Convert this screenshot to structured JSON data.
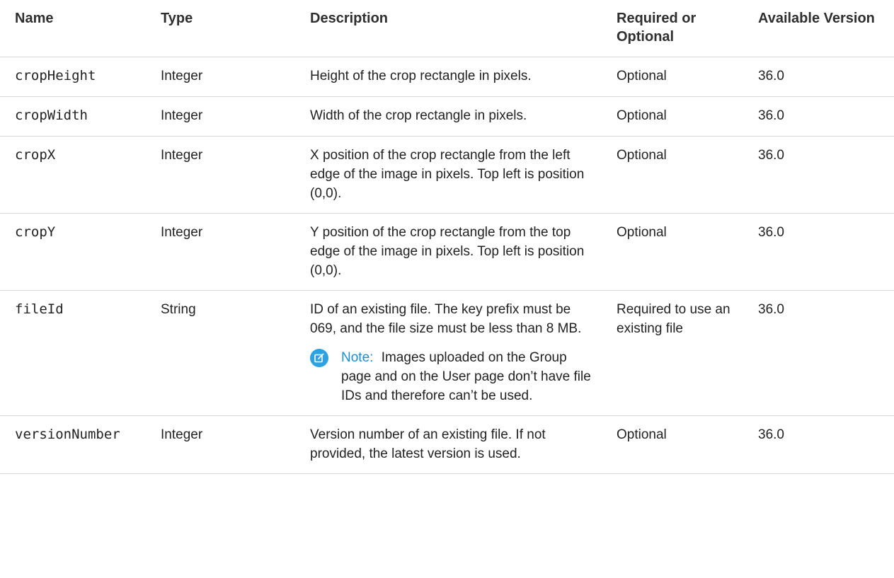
{
  "headers": {
    "name": "Name",
    "type": "Type",
    "description": "Description",
    "required": "Required or Optional",
    "version": "Available Version"
  },
  "rows": [
    {
      "name": "cropHeight",
      "type": "Integer",
      "description": "Height of the crop rectangle in pixels.",
      "required": "Optional",
      "version": "36.0"
    },
    {
      "name": "cropWidth",
      "type": "Integer",
      "description": "Width of the crop rectangle in pixels.",
      "required": "Optional",
      "version": "36.0"
    },
    {
      "name": "cropX",
      "type": "Integer",
      "description": "X position of the crop rectangle from the left edge of the image in pixels. Top left is position (0,0).",
      "required": "Optional",
      "version": "36.0"
    },
    {
      "name": "cropY",
      "type": "Integer",
      "description": "Y position of the crop rectangle from the top edge of the image in pixels. Top left is position (0,0).",
      "required": "Optional",
      "version": "36.0"
    },
    {
      "name": "fileId",
      "type": "String",
      "description": "ID of an existing file. The key prefix must be 069, and the file size must be less than 8 MB.",
      "note_label": "Note:",
      "note_text": "Images uploaded on the Group page and on the User page don’t have file IDs and therefore can’t be used.",
      "required": "Required to use an existing file",
      "version": "36.0"
    },
    {
      "name": "versionNumber",
      "type": "Integer",
      "description": "Version number of an existing file. If not provided, the latest version is used.",
      "required": "Optional",
      "version": "36.0"
    }
  ],
  "icons": {
    "note": "edit-note-icon"
  },
  "colors": {
    "note_accent": "#1a8ed0",
    "note_icon_bg": "#2ea2e0"
  }
}
